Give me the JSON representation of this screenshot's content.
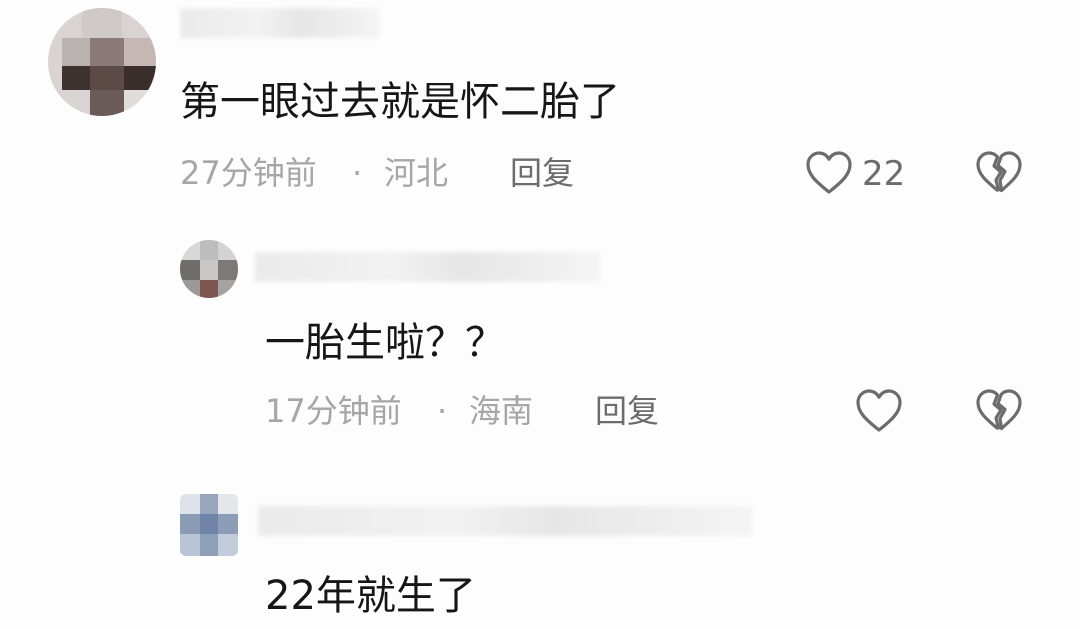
{
  "comments": [
    {
      "text": "第一眼过去就是怀二胎了",
      "time": "27分钟前",
      "separator": "·",
      "location": "河北",
      "reply_label": "回复",
      "like_count": "22",
      "like_icon": "heart-outline-icon",
      "dislike_icon": "broken-heart-icon"
    },
    {
      "text": "一胎生啦？？",
      "time": "17分钟前",
      "separator": "·",
      "location": "海南",
      "reply_label": "回复",
      "like_icon": "heart-outline-icon",
      "dislike_icon": "broken-heart-icon"
    },
    {
      "text": "22年就生了"
    }
  ],
  "colors": {
    "text": "#161616",
    "meta": "#a6a6a6",
    "action": "#6c6c6c"
  }
}
